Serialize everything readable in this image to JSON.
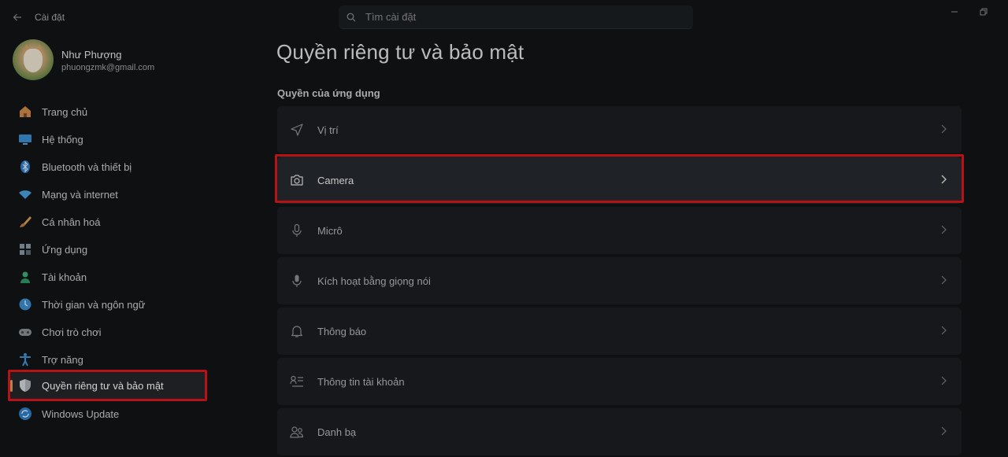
{
  "window": {
    "title": "Cài đặt",
    "search_placeholder": "Tìm cài đặt"
  },
  "profile": {
    "name": "Như Phượng",
    "email": "phuongzmk@gmail.com"
  },
  "sidebar": {
    "items": [
      {
        "label": "Trang chủ",
        "icon": "home-icon"
      },
      {
        "label": "Hệ thống",
        "icon": "monitor-icon"
      },
      {
        "label": "Bluetooth và thiết bị",
        "icon": "bluetooth-icon"
      },
      {
        "label": "Mạng và internet",
        "icon": "wifi-icon"
      },
      {
        "label": "Cá nhân hoá",
        "icon": "brush-icon"
      },
      {
        "label": "Ứng dụng",
        "icon": "apps-icon"
      },
      {
        "label": "Tài khoản",
        "icon": "person-icon"
      },
      {
        "label": "Thời gian và ngôn ngữ",
        "icon": "globe-clock-icon"
      },
      {
        "label": "Chơi trò chơi",
        "icon": "gamepad-icon"
      },
      {
        "label": "Trợ năng",
        "icon": "accessibility-icon"
      },
      {
        "label": "Quyền riêng tư và bảo mật",
        "icon": "shield-icon",
        "selected": true
      },
      {
        "label": "Windows Update",
        "icon": "update-icon"
      }
    ]
  },
  "main": {
    "title": "Quyền riêng tư và bảo mật",
    "section_label": "Quyền của ứng dụng",
    "rows": [
      {
        "label": "Vị trí",
        "icon": "location-icon"
      },
      {
        "label": "Camera",
        "icon": "camera-icon",
        "active": true
      },
      {
        "label": "Micrô",
        "icon": "microphone-icon"
      },
      {
        "label": "Kích hoạt bằng giọng nói",
        "icon": "voice-mic-icon"
      },
      {
        "label": "Thông báo",
        "icon": "bell-icon"
      },
      {
        "label": "Thông tin tài khoản",
        "icon": "account-info-icon"
      },
      {
        "label": "Danh bạ",
        "icon": "contacts-icon"
      }
    ]
  },
  "colors": {
    "background": "#121416",
    "card": "#1b1e21",
    "highlight": "#e0181c",
    "accent": "#d8a064"
  }
}
